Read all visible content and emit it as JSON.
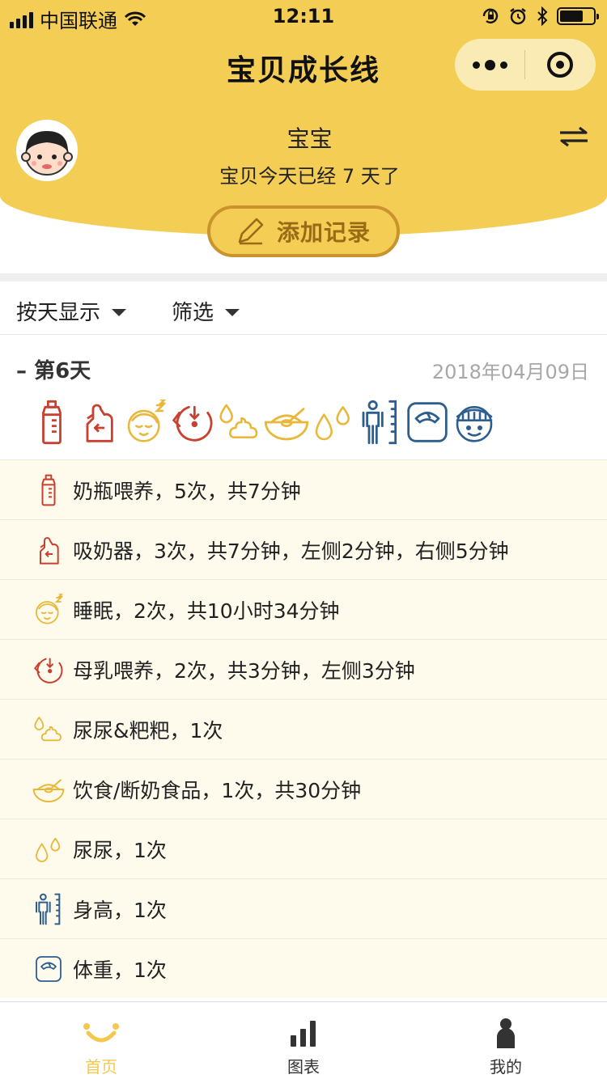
{
  "status_bar": {
    "carrier": "中国联通",
    "time": "12:11"
  },
  "header": {
    "title": "宝贝成长线",
    "baby_name": "宝宝",
    "baby_age_text": "宝贝今天已经 7 天了",
    "add_button_label": "添加记录"
  },
  "filters": {
    "view_mode_label": "按天显示",
    "filter_label": "筛选"
  },
  "day": {
    "title": "第6天",
    "collapse_symbol": "–",
    "date": "2018年04月09日",
    "icons": [
      "bottle-icon",
      "breast-pump-icon",
      "sleep-icon",
      "breastfeed-icon",
      "pee-poo-icon",
      "food-bowl-icon",
      "pee-icon",
      "height-icon",
      "weight-scale-icon",
      "head-circumference-icon"
    ]
  },
  "records": [
    {
      "icon": "bottle-icon",
      "text": "奶瓶喂养，5次，共7分钟"
    },
    {
      "icon": "breast-pump-icon",
      "text": "吸奶器，3次，共7分钟，左侧2分钟，右侧5分钟"
    },
    {
      "icon": "sleep-icon",
      "text": "睡眠，2次，共10小时34分钟"
    },
    {
      "icon": "breastfeed-icon",
      "text": "母乳喂养，2次，共3分钟，左侧3分钟"
    },
    {
      "icon": "pee-poo-icon",
      "text": "尿尿&粑粑，1次"
    },
    {
      "icon": "food-bowl-icon",
      "text": "饮食/断奶食品，1次，共30分钟"
    },
    {
      "icon": "pee-icon",
      "text": "尿尿，1次"
    },
    {
      "icon": "height-icon",
      "text": "身高，1次"
    },
    {
      "icon": "weight-scale-icon",
      "text": "体重，1次"
    }
  ],
  "tabbar": {
    "tabs": [
      {
        "label": "首页",
        "icon": "smile-icon",
        "active": true
      },
      {
        "label": "图表",
        "icon": "bar-chart-icon",
        "active": false
      },
      {
        "label": "我的",
        "icon": "person-icon",
        "active": false
      }
    ]
  },
  "colors": {
    "brand_yellow": "#F4CD55",
    "active_tab": "#F4C84E",
    "record_bg": "#FEFAEC",
    "icon_red": "#C8402F",
    "icon_yellow": "#E9B83A",
    "icon_blue": "#2E5E8E"
  }
}
